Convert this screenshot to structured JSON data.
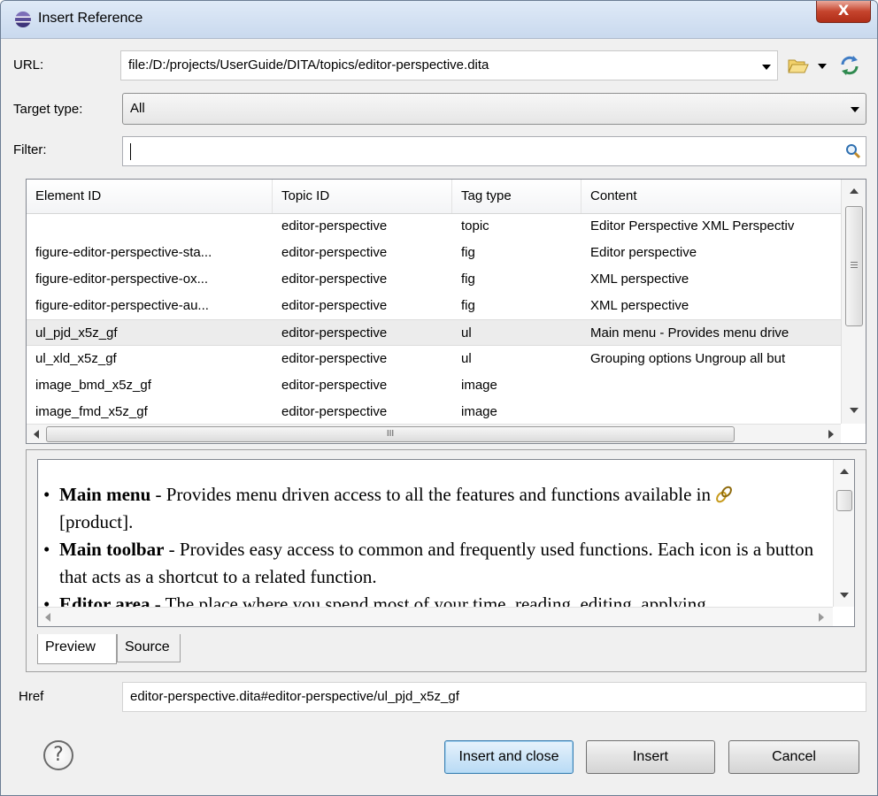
{
  "window": {
    "title": "Insert Reference",
    "close_label": "X"
  },
  "url": {
    "label": "URL:",
    "value": "file:/D:/projects/UserGuide/DITA/topics/editor-perspective.dita"
  },
  "target_type": {
    "label": "Target type:",
    "value": "All"
  },
  "filter": {
    "label": "Filter:",
    "value": "",
    "placeholder": ""
  },
  "table": {
    "headers": [
      "Element ID",
      "Topic ID",
      "Tag type",
      "Content"
    ],
    "rows": [
      [
        "",
        "editor-perspective",
        "topic",
        "Editor Perspective XML Perspectiv"
      ],
      [
        "figure-editor-perspective-sta...",
        "editor-perspective",
        "fig",
        "Editor perspective"
      ],
      [
        "figure-editor-perspective-ox...",
        "editor-perspective",
        "fig",
        "XML perspective"
      ],
      [
        "figure-editor-perspective-au...",
        "editor-perspective",
        "fig",
        "XML perspective"
      ],
      [
        "ul_pjd_x5z_gf",
        "editor-perspective",
        "ul",
        "Main menu - Provides menu drive"
      ],
      [
        "ul_xld_x5z_gf",
        "editor-perspective",
        "ul",
        "Grouping options Ungroup all but"
      ],
      [
        "image_bmd_x5z_gf",
        "editor-perspective",
        "image",
        ""
      ],
      [
        "image_fmd_x5z_gf",
        "editor-perspective",
        "image",
        ""
      ]
    ],
    "selected_row": 4,
    "hscroll_label": "III"
  },
  "preview": {
    "items": [
      {
        "term": "Main menu",
        "text": " - Provides menu driven access to all the features and functions available in ",
        "extra": "[product]."
      },
      {
        "term": "Main toolbar",
        "text": " - Provides easy access to common and frequently used functions. Each icon is a button that acts as a shortcut to a related function."
      },
      {
        "term": "Editor area",
        "text": " - The place where you spend most of your time, reading, editing, applying"
      }
    ],
    "tabs": [
      "Preview",
      "Source"
    ],
    "active_tab": "Preview"
  },
  "href": {
    "label": "Href",
    "value": "editor-perspective.dita#editor-perspective/ul_pjd_x5z_gf"
  },
  "buttons": {
    "help": "?",
    "insert_close": "Insert and close",
    "insert": "Insert",
    "cancel": "Cancel"
  },
  "icons": {
    "title": "eclipse-icon",
    "open": "folder-open-icon",
    "reload": "reload-icon",
    "search": "search-icon",
    "link": "link-icon",
    "help": "help-icon"
  }
}
